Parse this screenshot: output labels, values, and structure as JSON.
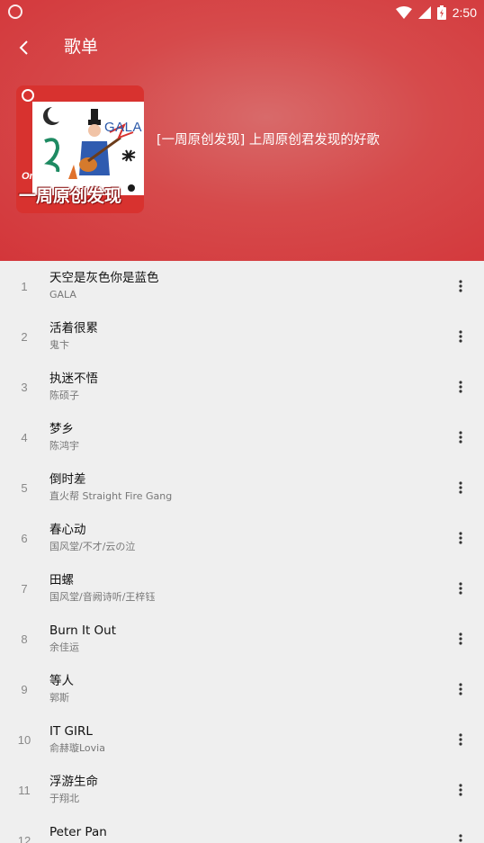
{
  "status_bar": {
    "time": "2:50"
  },
  "toolbar": {
    "title": "歌单",
    "back_icon": "back-arrow-icon"
  },
  "playlist": {
    "cover": {
      "brand": "GALA",
      "original_label": "Original",
      "tagline": "一周原创发现"
    },
    "description": "[一周原创发现] 上周原创君发现的好歌"
  },
  "colors": {
    "header_red": "#d64a4b",
    "list_bg": "#efefef",
    "title_text": "#111111",
    "subtitle_text": "#777777"
  },
  "songs": [
    {
      "index": "1",
      "title": "天空是灰色你是蓝色",
      "artist": "GALA"
    },
    {
      "index": "2",
      "title": "活着很累",
      "artist": "鬼卞"
    },
    {
      "index": "3",
      "title": "执迷不悟",
      "artist": "陈硕子"
    },
    {
      "index": "4",
      "title": "梦乡",
      "artist": "陈鸿宇"
    },
    {
      "index": "5",
      "title": "倒时差",
      "artist": "直火帮 Straight Fire Gang"
    },
    {
      "index": "6",
      "title": "春心动",
      "artist": "国风堂/不才/云の泣"
    },
    {
      "index": "7",
      "title": "田螺",
      "artist": "国风堂/音阙诗听/王梓钰"
    },
    {
      "index": "8",
      "title": "Burn It Out",
      "artist": "余佳运"
    },
    {
      "index": "9",
      "title": "等人",
      "artist": "郭斯"
    },
    {
      "index": "10",
      "title": "IT GIRL",
      "artist": "俞赫璇Lovia"
    },
    {
      "index": "11",
      "title": "浮游生命",
      "artist": "于翔北"
    },
    {
      "index": "12",
      "title": "Peter Pan",
      "artist": ""
    }
  ]
}
